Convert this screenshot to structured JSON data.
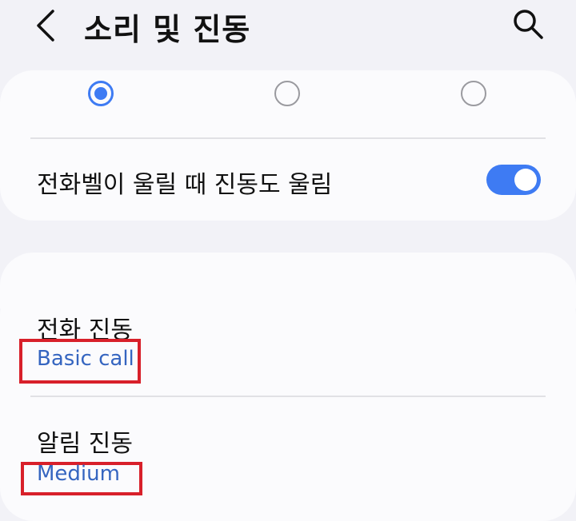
{
  "header": {
    "title": "소리 및 진동",
    "back_icon": "chevron-left-icon",
    "search_icon": "search-icon"
  },
  "vibration_pattern": {
    "options_count": 3,
    "selected_index": 0
  },
  "ring_vibrate": {
    "label": "전화벨이 울릴 때 진동도 울림",
    "enabled": true
  },
  "vibration_list": [
    {
      "title": "전화 진동",
      "value": "Basic call"
    },
    {
      "title": "알림 진동",
      "value": "Medium"
    }
  ],
  "colors": {
    "accent": "#3e7bf3",
    "value_text": "#3565c0",
    "highlight": "#d8202a",
    "background": "#f2f2f7",
    "card": "#fbfbfd"
  }
}
